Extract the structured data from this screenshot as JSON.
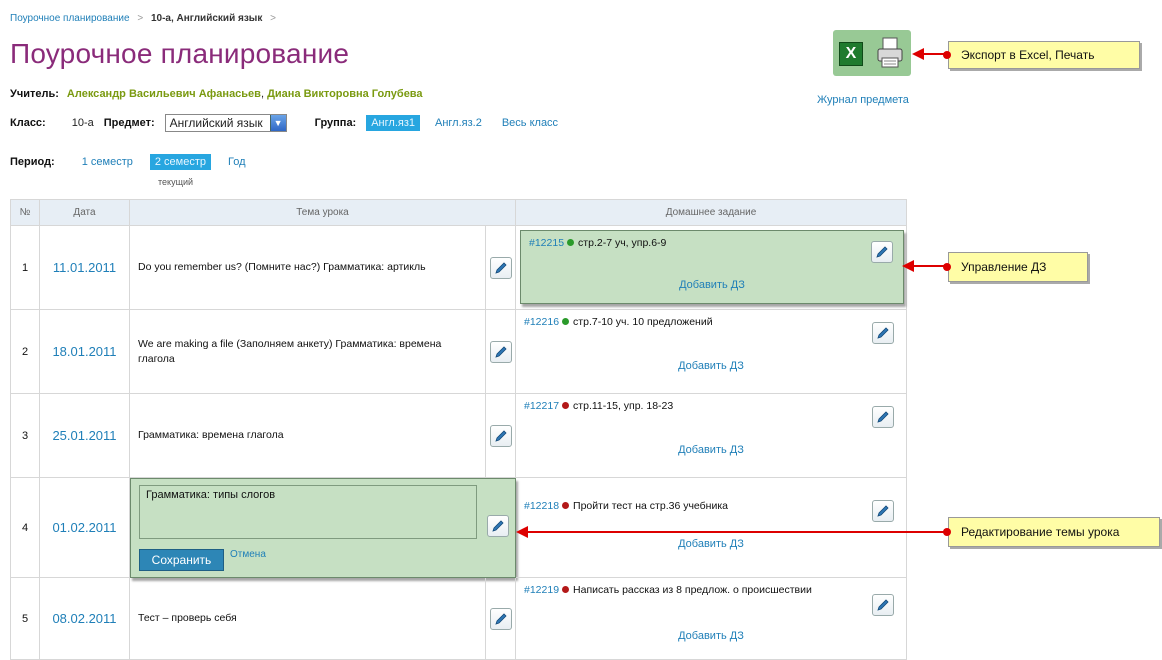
{
  "breadcrumb": {
    "root": "Поурочное планирование",
    "sep": ">",
    "current": "10-а, Английский язык",
    "tail": ">"
  },
  "page_title": "Поурочное планирование",
  "teacher": {
    "label": "Учитель:",
    "names": [
      "Александр Васильевич Афанасьев",
      "Диана Викторовна Голубева"
    ],
    "separator": ","
  },
  "class_row": {
    "label": "Класс:",
    "value": "10-а",
    "subject_label": "Предмет:",
    "subject_value": "Английский язык",
    "group_label": "Группа:",
    "groups": [
      "Англ.яз1",
      "Англ.яз.2",
      "Весь класс"
    ],
    "active_group": 0
  },
  "period": {
    "label": "Период:",
    "options": [
      "1 семестр",
      "2 семестр",
      "Год"
    ],
    "active": 1,
    "current_note": "текущий"
  },
  "tools": {
    "excel_icon": "excel-icon",
    "print_icon": "printer-icon",
    "journal_link": "Журнал предмета"
  },
  "callouts": {
    "export": "Экспорт в Excel, Печать",
    "hw_manage": "Управление ДЗ",
    "topic_edit": "Редактирование темы урока"
  },
  "colors": {
    "accent": "#8a2b7a",
    "link": "#1f7fb8",
    "highlight": "#c6e0c3",
    "callout": "#fffda6",
    "arrow": "#dd0000",
    "status_green": "#2a9a2a",
    "status_red": "#b31818"
  },
  "table": {
    "headers": {
      "num": "№",
      "date": "Дата",
      "topic": "Тема урока",
      "homework": "Домашнее задание"
    },
    "add_hw_label": "Добавить ДЗ",
    "rows": [
      {
        "num": "1",
        "date": "11.01.2011",
        "topic": "Do you remember us? (Помните нас?) Грамматика: артикль",
        "hw_id": "#12215",
        "hw_status": "green",
        "hw_text": "стр.2-7 уч, упр.6-9"
      },
      {
        "num": "2",
        "date": "18.01.2011",
        "topic": "We are making a file (Заполняем анкету) Грамматика: времена глагола",
        "hw_id": "#12216",
        "hw_status": "green",
        "hw_text": "стр.7-10 уч. 10 предложений"
      },
      {
        "num": "3",
        "date": "25.01.2011",
        "topic": "Грамматика: времена глагола",
        "hw_id": "#12217",
        "hw_status": "red",
        "hw_text": "стр.11-15, упр. 18-23"
      },
      {
        "num": "4",
        "date": "01.02.2011",
        "topic": "Грамматика: типы слогов",
        "hw_id": "#12218",
        "hw_status": "red",
        "hw_text": "Пройти тест на стр.36 учебника"
      },
      {
        "num": "5",
        "date": "08.02.2011",
        "topic": "Тест – проверь себя",
        "hw_id": "#12219",
        "hw_status": "red",
        "hw_text": "Написать рассказ из 8 предлож. о происшествии"
      }
    ],
    "edit_row": {
      "save_label": "Сохранить",
      "cancel_label": "Отмена"
    }
  }
}
